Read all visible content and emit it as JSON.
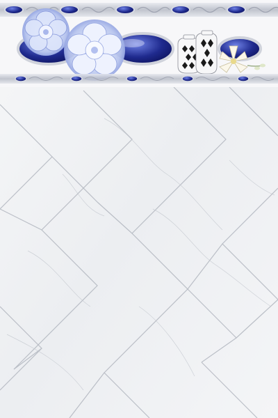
{
  "scene": {
    "subject": "ceramic-wall-tile-design",
    "palette": {
      "marble": "#f1f2f4",
      "vein": "#c4c8cf",
      "grout": "#a9aeb8",
      "cobalt": "#1f2a8e",
      "cobalt_light": "#4a5bd0",
      "silver": "#c9ccd4",
      "petal": "#b9c6ee",
      "petal_light": "#e8eefc",
      "vase_white": "#f7f7f8",
      "vase_black": "#1a1a1a",
      "lily": "#fbf7ea"
    },
    "icons": [
      "blue-peony-icon",
      "blue-gem-icon",
      "vase-icon",
      "lily-icon"
    ]
  }
}
